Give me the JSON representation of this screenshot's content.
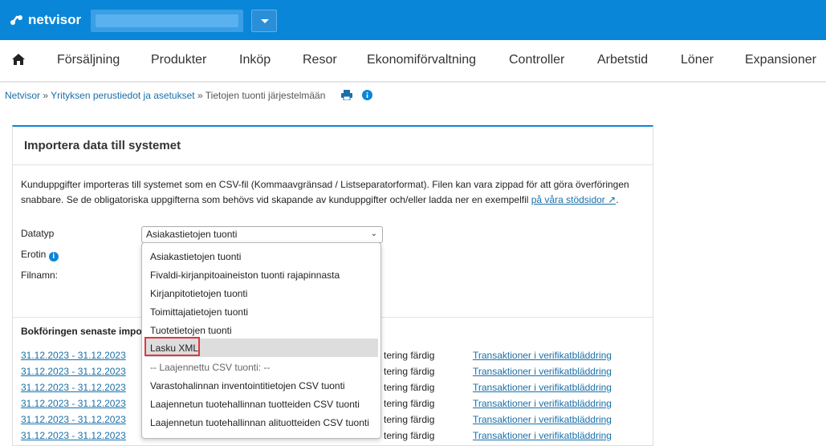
{
  "header": {
    "logo_text": "netvisor",
    "colors": {
      "brand": "#0a86d8",
      "link": "#1a6fa8",
      "highlight_border": "#e0383e"
    }
  },
  "nav": {
    "home_icon": "home-icon",
    "items": [
      "Försäljning",
      "Produkter",
      "Inköp",
      "Resor",
      "Ekonomiförvaltning",
      "Controller",
      "Arbetstid",
      "Löner",
      "Expansioner"
    ]
  },
  "breadcrumb": {
    "items": [
      "Netvisor",
      "Yrityksen perustiedot ja asetukset",
      "Tietojen tuonti järjestelmään"
    ],
    "separator": "»",
    "icons": [
      "print-icon",
      "info-icon"
    ]
  },
  "panel": {
    "title": "Importera data till systemet",
    "description": "Kunduppgifter importeras till systemet som en CSV-fil (Kommaavgränsad / Listseparatorformat). Filen kan vara zippad för att göra överföringen snabbare. Se de obligatoriska uppgifterna som behövs vid skapande av kunduppgifter och/eller ladda ner en exempelfil",
    "description_link": "på våra stödsidor ↗",
    "description_end": ".",
    "labels": {
      "datatype": "Datatyp",
      "separator": "Erotin",
      "filename": "Filnamn:"
    },
    "select_value": "Asiakastietojen tuonti",
    "latest_title": "Bokföringen senaste impo",
    "rows": [
      {
        "date": "31.12.2023 - 31.12.2023",
        "status": "tering färdig",
        "link": "Transaktioner i verifikatbläddring"
      },
      {
        "date": "31.12.2023 - 31.12.2023",
        "status": "tering färdig",
        "link": "Transaktioner i verifikatbläddring"
      },
      {
        "date": "31.12.2023 - 31.12.2023",
        "status": "tering färdig",
        "link": "Transaktioner i verifikatbläddring"
      },
      {
        "date": "31.12.2023 - 31.12.2023",
        "status": "tering färdig",
        "link": "Transaktioner i verifikatbläddring"
      },
      {
        "date": "31.12.2023 - 31.12.2023",
        "status": "tering färdig",
        "link": "Transaktioner i verifikatbläddring"
      },
      {
        "date": "31.12.2023 - 31.12.2023",
        "status": "tering färdig",
        "link": "Transaktioner i verifikatbläddring"
      }
    ]
  },
  "dropdown": {
    "options": [
      "Asiakastietojen tuonti",
      "Fivaldi-kirjanpitoaineiston tuonti rajapinnasta",
      "Kirjanpitotietojen tuonti",
      "Toimittajatietojen tuonti",
      "Tuotetietojen tuonti",
      "Lasku XML",
      "-- Laajennettu CSV tuonti: --",
      "Varastohalinnan inventointitietojen CSV tuonti",
      "Laajennetun tuotehallinnan tuotteiden CSV tuonti",
      "Laajennetun tuotehallinnan alituotteiden CSV tuonti"
    ],
    "highlighted": "Lasku XML"
  }
}
